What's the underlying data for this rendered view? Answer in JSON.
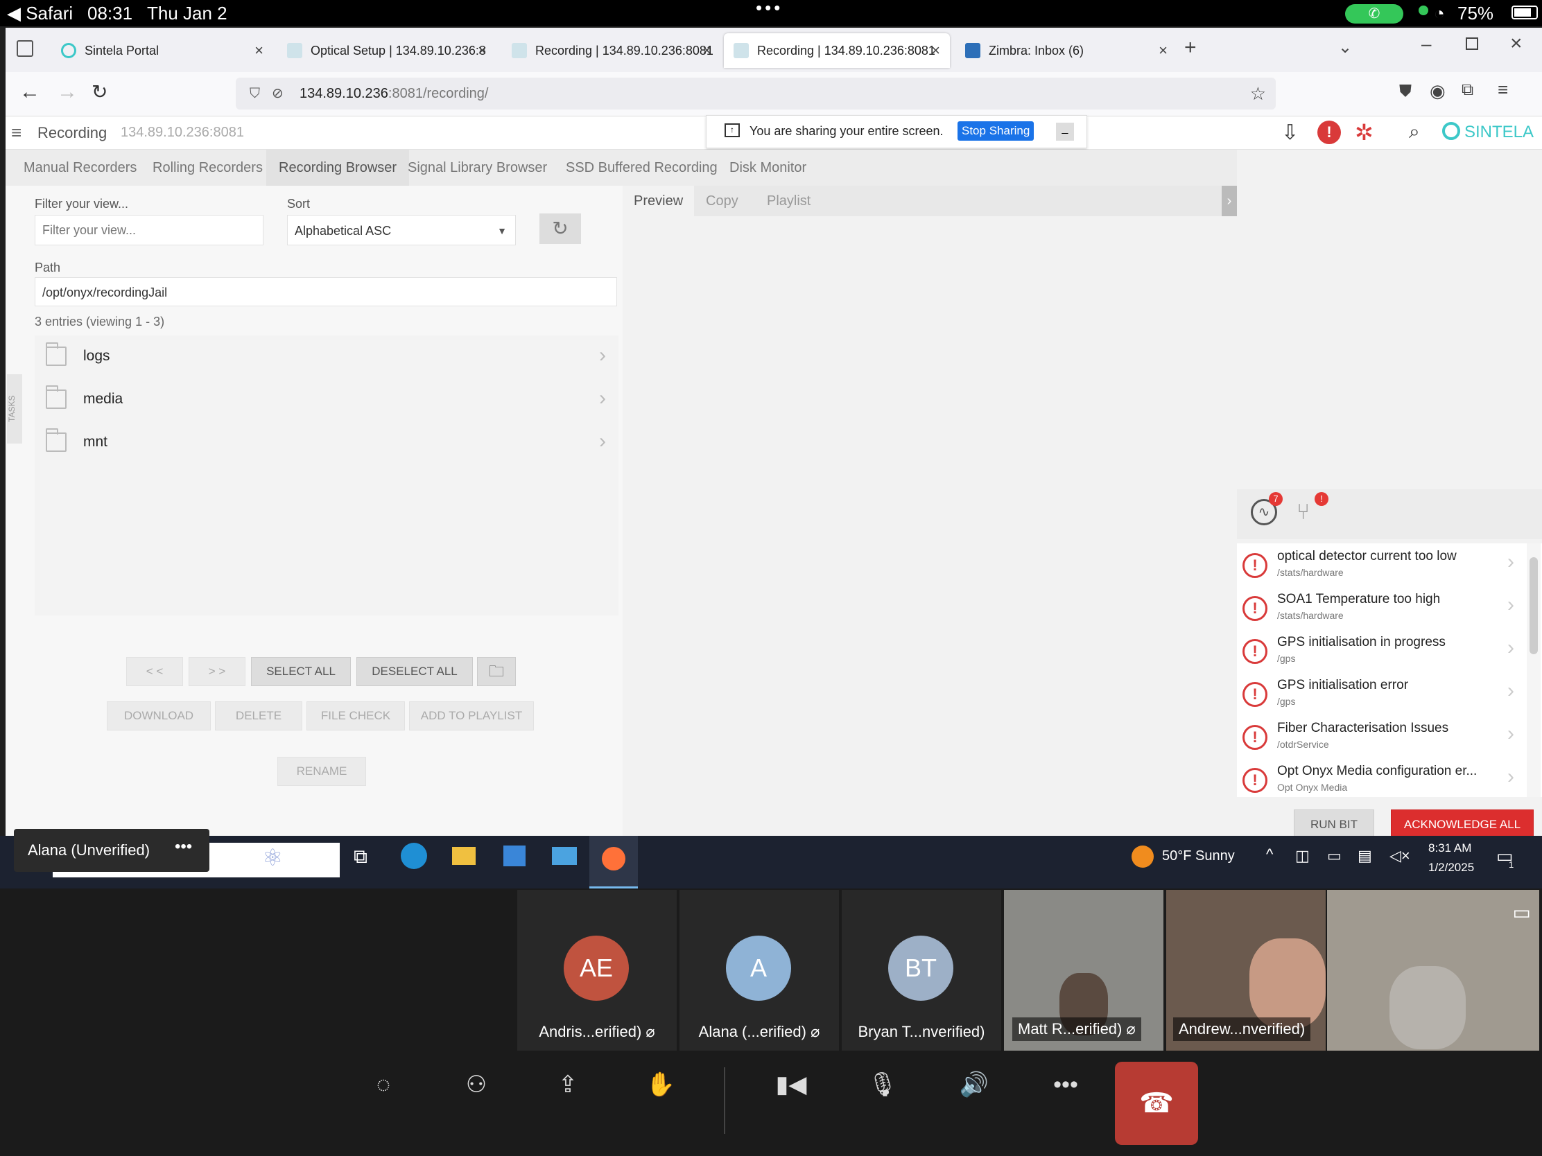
{
  "ios": {
    "app": "Safari",
    "time": "08:31",
    "date": "Thu Jan 2",
    "battery": "75%"
  },
  "browser": {
    "tabs": [
      {
        "title": "Sintela Portal"
      },
      {
        "title": "Optical Setup | 134.89.10.236:8"
      },
      {
        "title": "Recording | 134.89.10.236:8081"
      },
      {
        "title": "Recording | 134.89.10.236:8081"
      },
      {
        "title": "Zimbra: Inbox (6)"
      }
    ],
    "url_host": "134.89.10.236",
    "url_rest": ":8081/recording/"
  },
  "app": {
    "title": "Recording",
    "host": "134.89.10.236:8081",
    "share_text": "You are sharing your entire screen.",
    "stop_sharing": "Stop Sharing",
    "brand": "SINTELA",
    "brand_color": "#3cc8c8",
    "subtabs": [
      "Manual Recorders",
      "Rolling Recorders",
      "Recording Browser",
      "Signal Library Browser",
      "SSD Buffered Recording",
      "Disk Monitor"
    ],
    "filter_label": "Filter your view...",
    "filter_placeholder": "Filter your view...",
    "sort_label": "Sort",
    "sort_value": "Alphabetical ASC",
    "path_label": "Path",
    "path_value": "/opt/onyx/recordingJail",
    "entries_text": "3 entries (viewing 1 - 3)",
    "entries": [
      {
        "name": "logs"
      },
      {
        "name": "media"
      },
      {
        "name": "mnt"
      }
    ],
    "buttons": {
      "prev": "< <",
      "next": "> >",
      "select_all": "SELECT ALL",
      "deselect_all": "DESELECT ALL",
      "download": "DOWNLOAD",
      "delete": "DELETE",
      "file_check": "FILE CHECK",
      "add_to_playlist": "ADD TO PLAYLIST",
      "rename": "RENAME"
    },
    "preview_tabs": [
      "Preview",
      "Copy",
      "Playlist"
    ],
    "tasks_label": "TASKS",
    "alert_badge_1": "7",
    "alert_badge_2": "!",
    "alerts": [
      {
        "title": "optical detector current too low",
        "sub": "/stats/hardware"
      },
      {
        "title": "SOA1 Temperature too high",
        "sub": "/stats/hardware"
      },
      {
        "title": "GPS initialisation in progress",
        "sub": "/gps"
      },
      {
        "title": "GPS initialisation error",
        "sub": "/gps"
      },
      {
        "title": "Fiber Characterisation Issues",
        "sub": "/otdrService"
      },
      {
        "title": "Opt Onyx Media configuration er...",
        "sub": "Opt Onyx Media"
      }
    ],
    "run_bit": "RUN BIT",
    "ack_all": "ACKNOWLEDGE ALL"
  },
  "taskbar": {
    "search_fragment": "ch",
    "weather": "50°F Sunny",
    "time": "8:31 AM",
    "date": "1/2/2025",
    "notif_count": "1"
  },
  "teams": {
    "presenter": "Alana (Unverified)",
    "participants": [
      {
        "initials": "AE",
        "name": "Andris...erified)",
        "color": "#c0533f"
      },
      {
        "initials": "A",
        "name": "Alana (...erified)",
        "color": "#8fb3d6"
      },
      {
        "initials": "BT",
        "name": "Bryan T...nverified)",
        "color": "#9db0c7"
      },
      {
        "initials": "",
        "name": "Matt R...erified)",
        "color": "#8a8a86"
      },
      {
        "initials": "",
        "name": "Andrew...nverified)",
        "color": "#6b5a4e"
      },
      {
        "initials": "",
        "name": "",
        "color": "#a09a90"
      }
    ]
  }
}
